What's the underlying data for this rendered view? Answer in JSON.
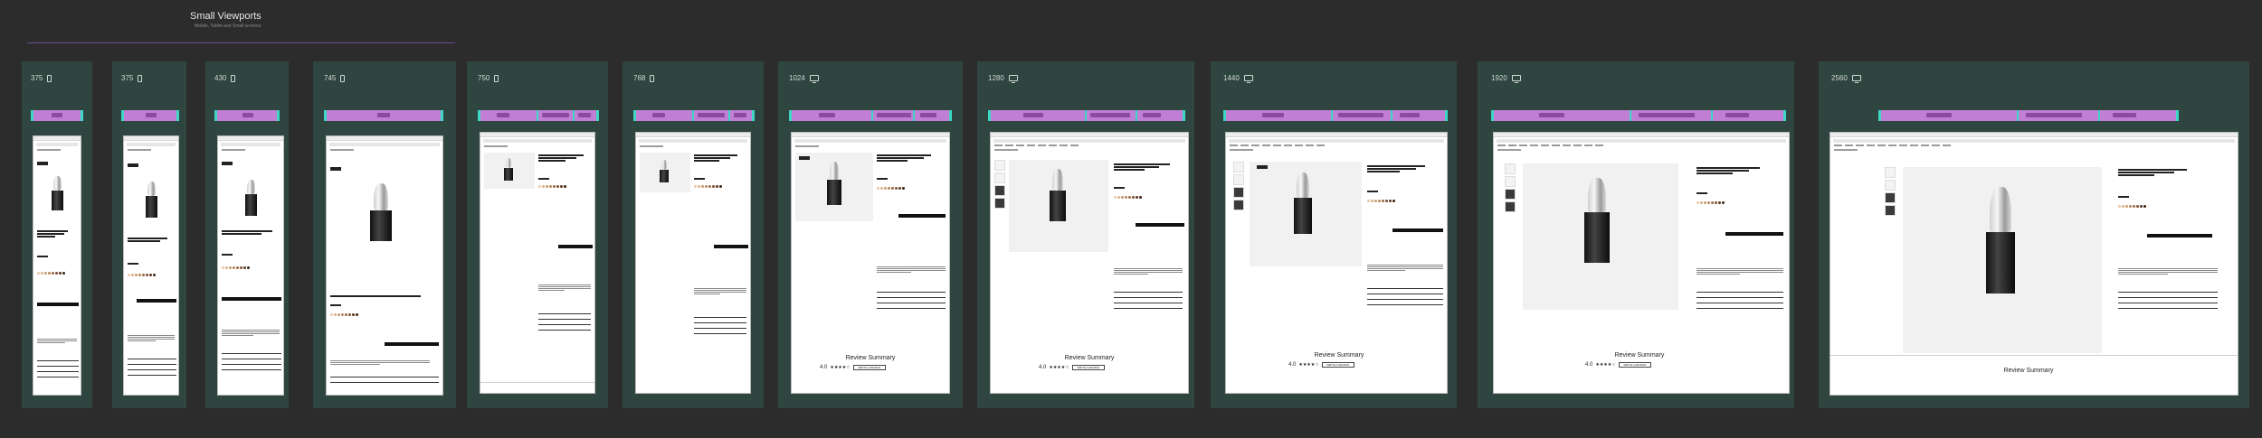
{
  "section": {
    "title": "Small Viewports",
    "subtitle": "Mobile, Tablet and Small screens"
  },
  "viewports": [
    {
      "label": "375",
      "device": "phone"
    },
    {
      "label": "375",
      "device": "phone"
    },
    {
      "label": "430",
      "device": "phone"
    },
    {
      "label": "745",
      "device": "phone"
    },
    {
      "label": "750",
      "device": "phone"
    },
    {
      "label": "768",
      "device": "phone"
    },
    {
      "label": "1024",
      "device": "monitor"
    },
    {
      "label": "1280",
      "device": "monitor"
    },
    {
      "label": "1440",
      "device": "monitor"
    },
    {
      "label": "1920",
      "device": "monitor"
    },
    {
      "label": "2560",
      "device": "monitor"
    }
  ],
  "review": {
    "title": "Review Summary",
    "rating": "4.0",
    "stars": "★★★★☆",
    "button": "WRITE A REVIEW"
  },
  "colors": {
    "canvas": "#2c2c2c",
    "board": "#2f4640",
    "annotation_bar": "#c07fd4",
    "annotation_edge": "#3ed6c4",
    "accent_line": "#6f4d8c"
  }
}
